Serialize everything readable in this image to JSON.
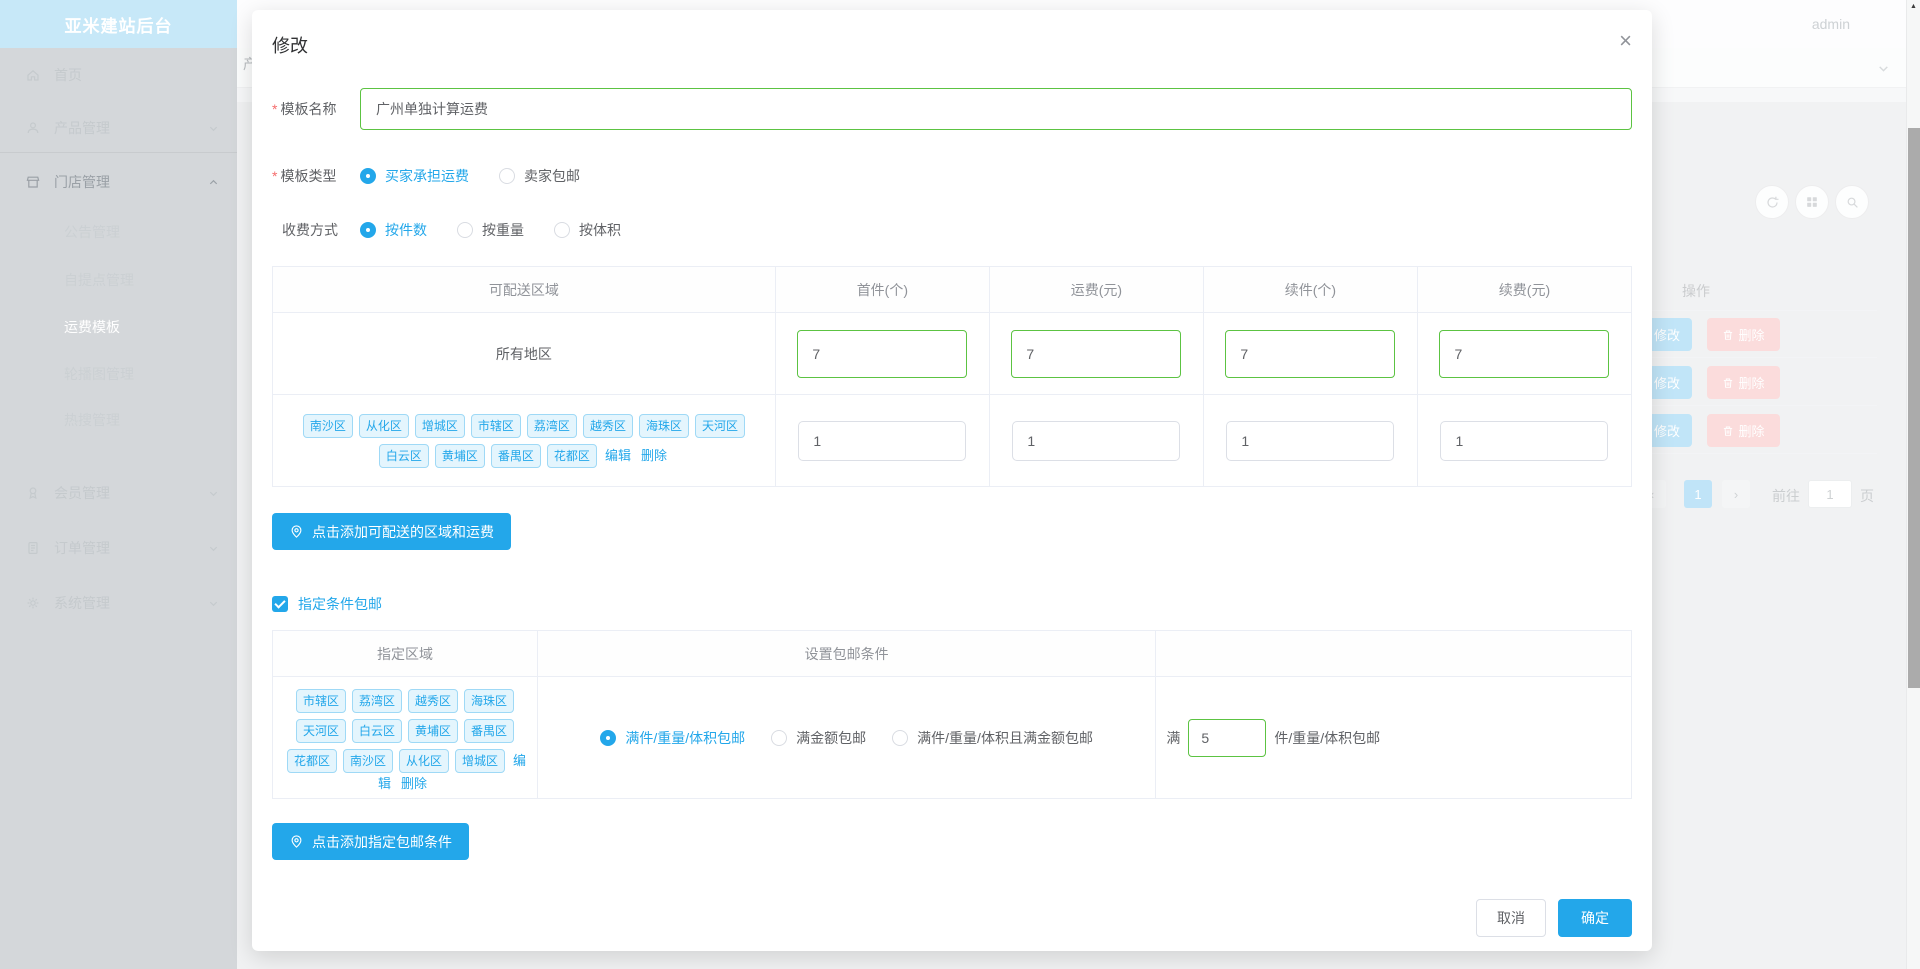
{
  "app": {
    "title": "亚米建站后台",
    "user": "admin"
  },
  "sidebar": {
    "items": [
      {
        "label": "首页"
      },
      {
        "label": "产品管理"
      },
      {
        "label": "门店管理",
        "children": [
          "公告管理",
          "自提点管理",
          "运费模板",
          "轮播图管理",
          "热搜管理"
        ]
      },
      {
        "label": "会员管理"
      },
      {
        "label": "订单管理"
      },
      {
        "label": "系统管理"
      }
    ]
  },
  "background": {
    "tab_fragment": "产",
    "operation_header": "操作",
    "rows": [
      {
        "edit": "修改",
        "remove": "删除"
      },
      {
        "edit": "修改",
        "remove": "删除"
      },
      {
        "edit": "修改",
        "remove": "删除"
      }
    ],
    "pagination": {
      "prev": "‹",
      "current": "1",
      "next": "›",
      "goto_label": "前往",
      "goto_value": "1",
      "page_unit": "页"
    },
    "scroll_up_icon": "▲"
  },
  "modal": {
    "title": "修改",
    "close_icon": "×",
    "required_mark": "*",
    "name_field": {
      "label": "模板名称",
      "value": "广州单独计算运费"
    },
    "type_field": {
      "label": "模板类型",
      "options": [
        {
          "label": "买家承担运费",
          "selected": true
        },
        {
          "label": "卖家包邮",
          "selected": false
        }
      ]
    },
    "charge_field": {
      "label": "收费方式",
      "options": [
        {
          "label": "按件数",
          "selected": true
        },
        {
          "label": "按重量",
          "selected": false
        },
        {
          "label": "按体积",
          "selected": false
        }
      ]
    },
    "shipping_table": {
      "headers": [
        "可配送区域",
        "首件(个)",
        "运费(元)",
        "续件(个)",
        "续费(元)"
      ],
      "row_all": {
        "region": "所有地区",
        "first": "7",
        "fee": "7",
        "additional": "7",
        "additional_fee": "7"
      },
      "row_custom": {
        "tags": [
          "南沙区",
          "从化区",
          "增城区",
          "市辖区",
          "荔湾区",
          "越秀区",
          "海珠区",
          "天河区",
          "白云区",
          "黄埔区",
          "番禺区",
          "花都区"
        ],
        "edit": "编辑",
        "remove": "删除",
        "first": "1",
        "fee": "1",
        "additional": "1",
        "additional_fee": "1"
      }
    },
    "add_region_button": "点击添加可配送的区域和运费",
    "free_condition_checkbox": "指定条件包邮",
    "condition_table": {
      "headers": [
        "指定区域",
        "设置包邮条件",
        ""
      ],
      "row": {
        "tags": [
          "市辖区",
          "荔湾区",
          "越秀区",
          "海珠区",
          "天河区",
          "白云区",
          "黄埔区",
          "番禺区",
          "花都区",
          "南沙区",
          "从化区",
          "增城区"
        ],
        "edit": "编辑",
        "remove": "删除",
        "options": [
          {
            "label": "满件/重量/体积包邮",
            "selected": true
          },
          {
            "label": "满金额包邮",
            "selected": false
          },
          {
            "label": "满件/重量/体积且满金额包邮",
            "selected": false
          }
        ],
        "threshold_prefix": "满",
        "threshold_value": "5",
        "threshold_suffix": "件/重量/体积包邮"
      }
    },
    "add_condition_button": "点击添加指定包邮条件",
    "cancel_button": "取消",
    "confirm_button": "确定"
  },
  "colors": {
    "primary": "#23a7ea",
    "success_border": "#5cc342",
    "danger": "#f56c6c",
    "tag_bg": "#e4f5fd",
    "tag_border": "#9fd9f6"
  }
}
